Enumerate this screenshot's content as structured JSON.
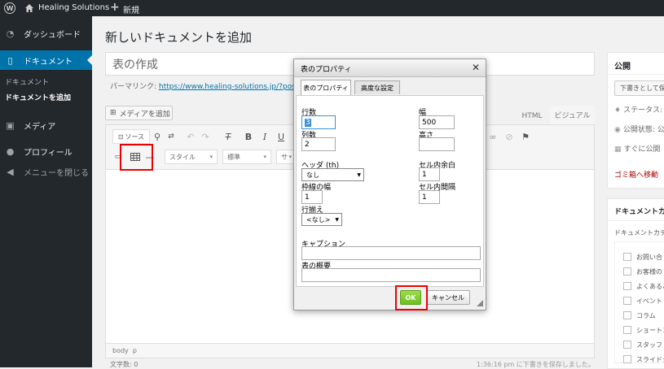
{
  "adminbar": {
    "site_name": "Healing Solutions",
    "new_label": "新規"
  },
  "sidebar": {
    "items": [
      {
        "label": "ダッシュボード"
      },
      {
        "label": "ドキュメント"
      },
      {
        "label": "メディア"
      },
      {
        "label": "プロフィール"
      },
      {
        "label": "メニューを閉じる"
      }
    ],
    "sub": [
      {
        "label": "ドキュメント"
      },
      {
        "label": "ドキュメントを追加"
      }
    ]
  },
  "page": {
    "title": "新しいドキュメントを追加",
    "post_title": "表の作成",
    "permalink_label": "パーマリンク:",
    "permalink_url": "https://www.healing-solutions.jp/?post_"
  },
  "editor": {
    "media_button": "メディアを追加",
    "tab_html": "HTML",
    "tab_visual": "ビジュアル",
    "source_label": "ソース",
    "style_select": "スタイル",
    "format_select": "標準",
    "size_select": "サ",
    "path": "body  p",
    "word_count": "文字数: 0",
    "draft_saved": "1:36:16 pm に下書きを保存しました。"
  },
  "dialog": {
    "title": "表のプロパティ",
    "tab1": "表のプロパティ",
    "tab2": "高度な設定",
    "rows_label": "行数",
    "rows_value": "3",
    "cols_label": "列数",
    "cols_value": "2",
    "width_label": "幅",
    "width_value": "500",
    "height_label": "高さ",
    "height_value": "",
    "header_label": "ヘッダ (th)",
    "header_value": "なし",
    "padding_label": "セル内余白",
    "padding_value": "1",
    "border_label": "枠線の幅",
    "border_value": "1",
    "spacing_label": "セル内間隔",
    "spacing_value": "1",
    "align_label": "行揃え",
    "align_value": "<なし>",
    "caption_label": "キャプション",
    "caption_value": "",
    "summary_label": "表の概要",
    "summary_value": "",
    "ok_label": "OK",
    "cancel_label": "キャンセル"
  },
  "publish": {
    "title": "公開",
    "save_draft": "下書きとして保",
    "status": "ステータス: 下",
    "visibility": "公開状態: 公",
    "schedule": "すぐに公開",
    "trash": "ゴミ箱へ移動"
  },
  "categories": {
    "title": "ドキュメントカテ",
    "tab": "ドキュメントカテ",
    "items": [
      "お問い合",
      "お客様の",
      "よくあるご",
      "イベント",
      "コラム",
      "ショートコ",
      "スタッフ",
      "スライドシ"
    ]
  }
}
